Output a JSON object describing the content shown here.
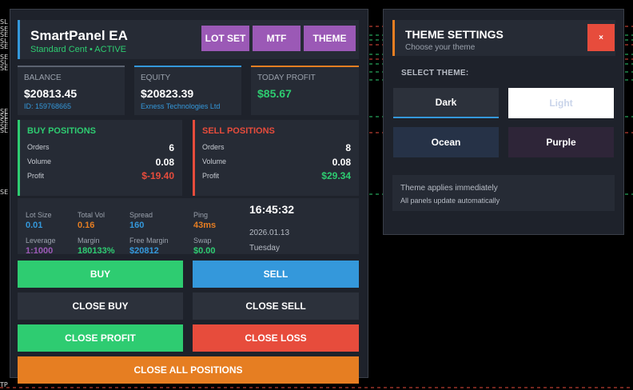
{
  "chart_bg": {
    "edge_labels": [
      "SL",
      "SE",
      "SE",
      "SL",
      "SE",
      "SE",
      "SL",
      "SE",
      "SE",
      "SE",
      "SE",
      "SE",
      "SL",
      "SE",
      "TP"
    ]
  },
  "header": {
    "title": "SmartPanel EA",
    "subtitle": "Standard Cent • ACTIVE",
    "buttons": {
      "lot_set": "LOT SET",
      "mtf": "MTF",
      "theme": "THEME"
    }
  },
  "stats": {
    "balance": {
      "label": "BALANCE",
      "value": "$20813.45",
      "sub": "ID: 159768665"
    },
    "equity": {
      "label": "EQUITY",
      "value": "$20823.39",
      "sub": "Exness Technologies Ltd"
    },
    "today_profit": {
      "label": "TODAY PROFIT",
      "value": "$85.67"
    }
  },
  "buy_positions": {
    "title": "BUY POSITIONS",
    "orders_label": "Orders",
    "orders": "6",
    "volume_label": "Volume",
    "volume": "0.08",
    "profit_label": "Profit",
    "profit": "$-19.40"
  },
  "sell_positions": {
    "title": "SELL POSITIONS",
    "orders_label": "Orders",
    "orders": "8",
    "volume_label": "Volume",
    "volume": "0.08",
    "profit_label": "Profit",
    "profit": "$29.34"
  },
  "info": {
    "lot_size": {
      "label": "Lot Size",
      "value": "0.01"
    },
    "total_vol": {
      "label": "Total Vol",
      "value": "0.16"
    },
    "spread": {
      "label": "Spread",
      "value": "160"
    },
    "ping": {
      "label": "Ping",
      "value": "43ms"
    },
    "leverage": {
      "label": "Leverage",
      "value": "1:1000"
    },
    "margin": {
      "label": "Margin",
      "value": "180133%"
    },
    "free_margin": {
      "label": "Free Margin",
      "value": "$20812"
    },
    "swap": {
      "label": "Swap",
      "value": "$0.00"
    },
    "time": "16:45:32",
    "date": "2026.01.13",
    "weekday": "Tuesday"
  },
  "actions": {
    "buy": "BUY",
    "sell": "SELL",
    "close_buy": "CLOSE BUY",
    "close_sell": "CLOSE SELL",
    "close_profit": "CLOSE PROFIT",
    "close_loss": "CLOSE LOSS",
    "close_all": "CLOSE ALL POSITIONS"
  },
  "theme_panel": {
    "title": "THEME SETTINGS",
    "subtitle": "Choose your theme",
    "close": "×",
    "select_label": "SELECT THEME:",
    "options": [
      "Dark",
      "Light",
      "Ocean",
      "Purple"
    ],
    "selected": "Dark",
    "note_main": "Theme applies immediately",
    "note_sub": "All panels update automatically"
  },
  "colors": {
    "accent_blue": "#3498db",
    "green": "#2ecc71",
    "red": "#e74c3c",
    "purple": "#9b59b6",
    "orange": "#e67e22",
    "panel_bg": "#1e222b",
    "card_bg": "#262b35"
  }
}
